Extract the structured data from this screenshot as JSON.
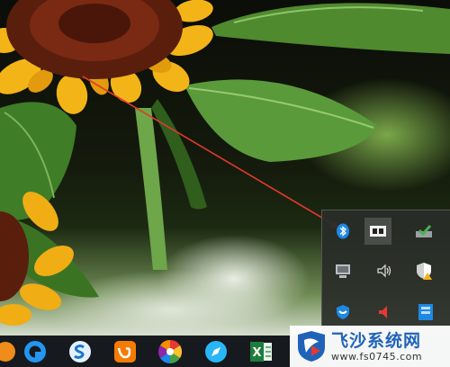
{
  "watermark": {
    "title": "飞沙系统网",
    "url": "www.fs0745.com"
  },
  "tray_popup": {
    "items": [
      {
        "icon": "bluetooth-icon"
      },
      {
        "icon": "media-display-icon",
        "highlighted": true
      },
      {
        "icon": "check-drive-icon"
      },
      {
        "icon": "network-monitor-icon"
      },
      {
        "icon": "speaker-icon"
      },
      {
        "icon": "security-shield-warning-icon"
      },
      {
        "icon": "shield-guard-icon"
      },
      {
        "icon": "red-speaker-icon"
      },
      {
        "icon": "blue-app-icon"
      }
    ]
  },
  "taskbar": {
    "apps": [
      {
        "icon": "partial-app-icon"
      },
      {
        "icon": "circle-app-icon"
      },
      {
        "icon": "sogou-s-icon"
      },
      {
        "icon": "uc-browser-icon"
      },
      {
        "icon": "pinwheel-icon"
      },
      {
        "icon": "compass-icon"
      },
      {
        "icon": "excel-icon",
        "text": "X"
      }
    ]
  },
  "colors": {
    "taskbar": "#16191d",
    "tray": "#2c2f2c",
    "annotation_arrow": "#e0392c",
    "watermark_text": "#1f63b8"
  }
}
